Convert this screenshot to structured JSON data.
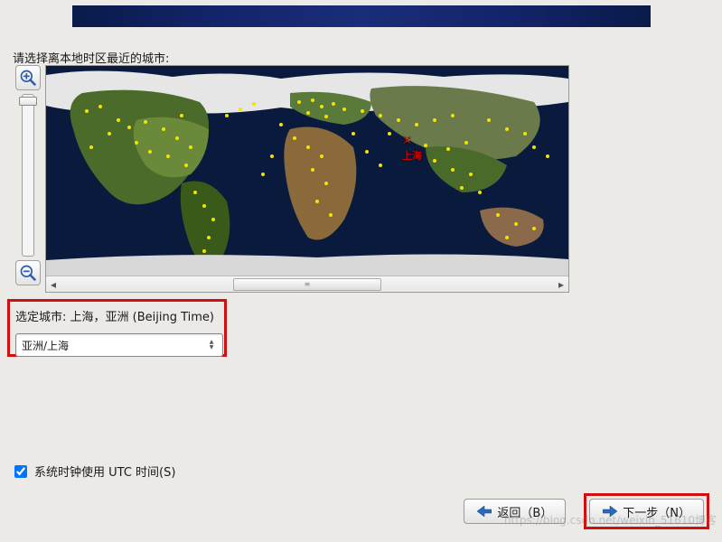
{
  "banner": {
    "title": ""
  },
  "prompt": "请选择离本地时区最近的城市:",
  "zoom": {
    "in_name": "zoom-in-icon",
    "out_name": "zoom-out-icon"
  },
  "map": {
    "selected_city_marker": "上海",
    "scrollbar_thumb_label": ""
  },
  "selection": {
    "label_prefix": "选定城市:",
    "city_display": "上海，亚洲 (Beijing Time)",
    "combo_value": "亚洲/上海"
  },
  "utc": {
    "checked": true,
    "label": "系统时钟使用 UTC 时间(S)"
  },
  "buttons": {
    "back": "返回（B）",
    "next": "下一步（N）"
  },
  "watermark": "https://blog.csdn.net/weixin_51610博客"
}
